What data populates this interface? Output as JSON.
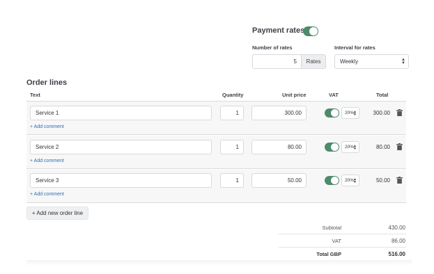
{
  "payment_rates": {
    "title": "Payment rates",
    "enabled": true,
    "number_of_rates_label": "Number of rates",
    "number_of_rates_value": "5",
    "rates_addon": "Rates",
    "interval_label": "Interval for rates",
    "interval_value": "Weekly"
  },
  "order_lines": {
    "title": "Order lines",
    "headers": {
      "text": "Text",
      "quantity": "Quantity",
      "unit_price": "Unit price",
      "vat": "VAT",
      "total": "Total"
    },
    "rows": [
      {
        "text": "Service 1",
        "quantity": "1",
        "unit_price": "300.00",
        "vat_on": true,
        "vat_rate": "20%",
        "total": "300.00",
        "add_comment": "+ Add comment"
      },
      {
        "text": "Service 2",
        "quantity": "1",
        "unit_price": "80.00",
        "vat_on": true,
        "vat_rate": "20%",
        "total": "80.00",
        "add_comment": "+ Add comment"
      },
      {
        "text": "Service 3",
        "quantity": "1",
        "unit_price": "50.00",
        "vat_on": true,
        "vat_rate": "20%",
        "total": "50.00",
        "add_comment": "+ Add comment"
      }
    ],
    "add_line_button": "+ Add new order line"
  },
  "summary": {
    "subtotal_label": "Subtotal",
    "subtotal_value": "430.00",
    "vat_label": "VAT",
    "vat_value": "86.00",
    "total_label": "Total GBP",
    "total_value": "516.00"
  },
  "colors": {
    "toggle_on": "#4e8a6c",
    "link": "#2f6fb0",
    "row_bg": "#f7f7f8"
  },
  "icons": {
    "delete": "trash-icon"
  }
}
